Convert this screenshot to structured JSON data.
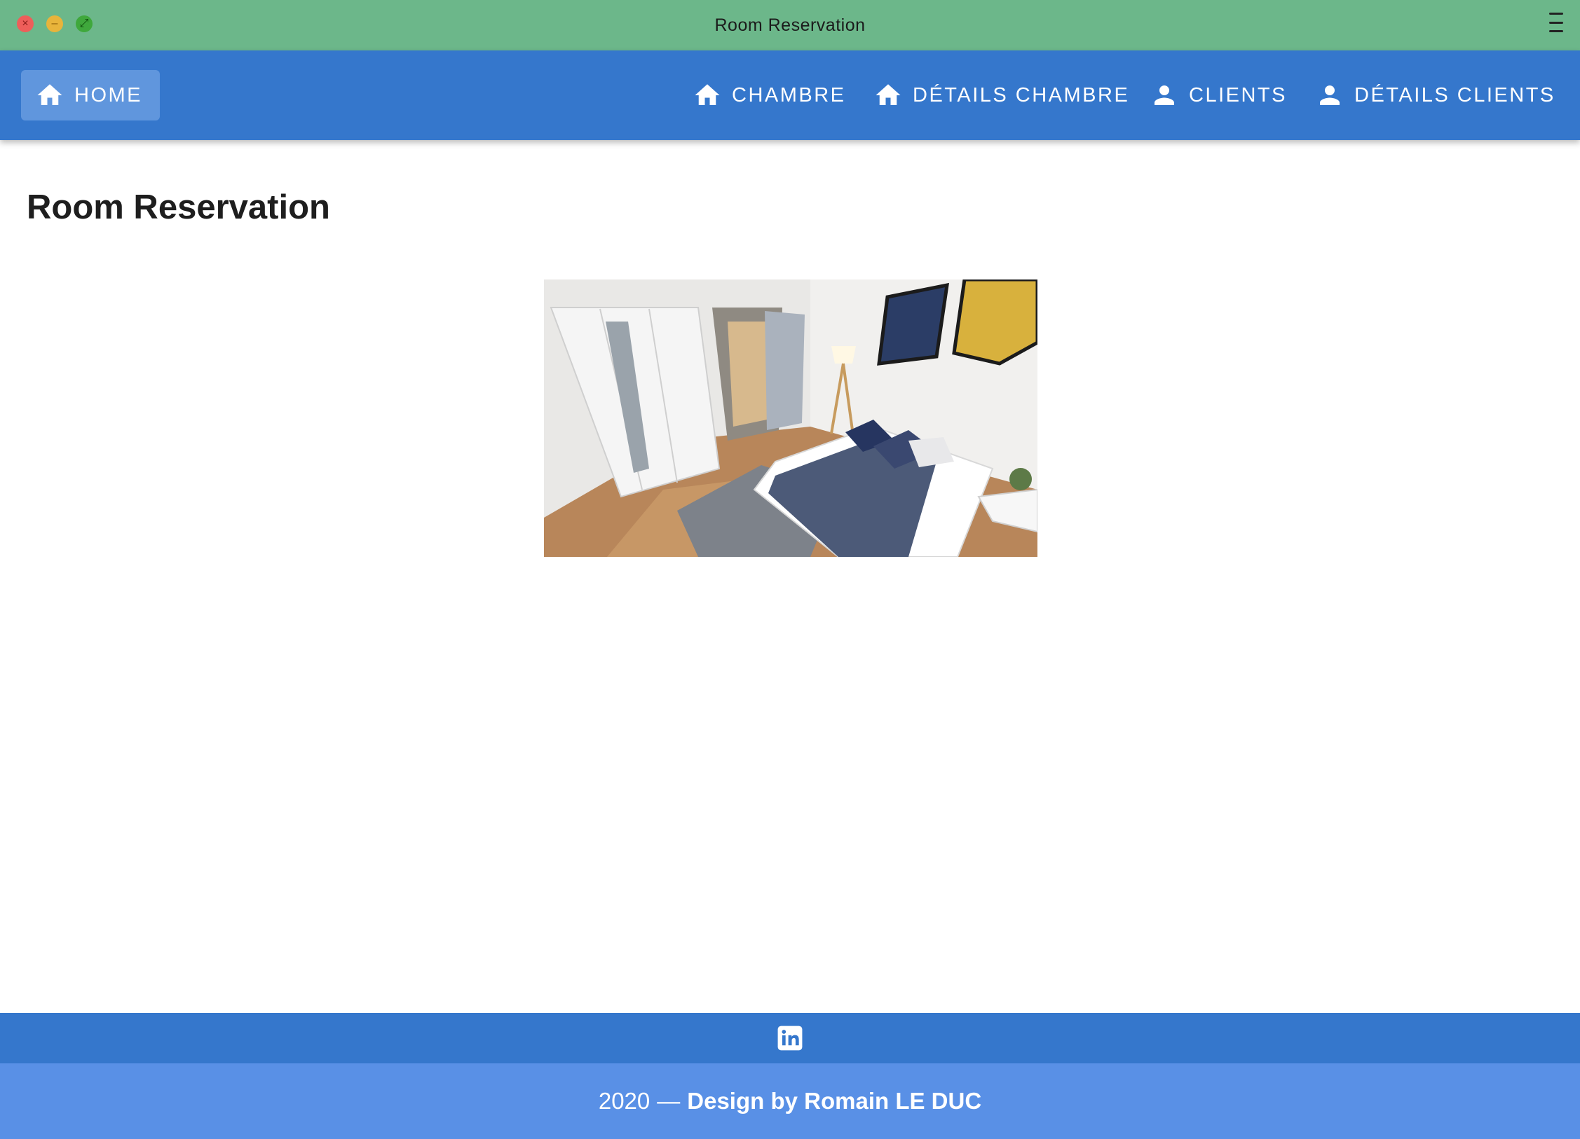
{
  "window": {
    "title": "Room Reservation",
    "controls": [
      "close",
      "minimize",
      "maximize"
    ],
    "menu_icon": "hamburger-icon"
  },
  "nav": {
    "accent": "#3577cc",
    "active": "home",
    "items": [
      {
        "id": "home",
        "label": "Home",
        "icon": "home-icon"
      },
      {
        "id": "chambre",
        "label": "Chambre",
        "icon": "home-icon"
      },
      {
        "id": "details_chambre",
        "label": "Détails Chambre",
        "icon": "home-icon"
      },
      {
        "id": "clients",
        "label": "Clients",
        "icon": "person-icon"
      },
      {
        "id": "details_clients",
        "label": "Détails Clients",
        "icon": "person-icon"
      }
    ]
  },
  "main": {
    "heading": "Room Reservation"
  },
  "footer": {
    "social_icon": "linkedin-icon",
    "year": "2020",
    "separator": "—",
    "credit": "Design by Romain LE DUC",
    "colors": {
      "top": "#3577cc",
      "bottom": "#5990e6"
    }
  }
}
